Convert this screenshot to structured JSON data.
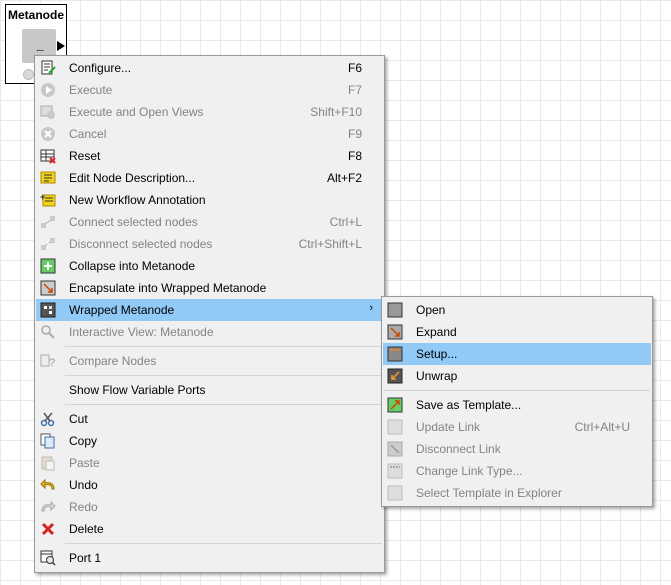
{
  "node": {
    "title": "Metanode",
    "dots": "...."
  },
  "main_menu": {
    "items": [
      {
        "label": "Configure...",
        "shortcut": "F6",
        "icon": "configure-icon"
      },
      {
        "label": "Execute",
        "shortcut": "F7",
        "icon": "execute-icon"
      },
      {
        "label": "Execute and Open Views",
        "shortcut": "Shift+F10",
        "icon": "execute-open-views-icon"
      },
      {
        "label": "Cancel",
        "shortcut": "F9",
        "icon": "cancel-icon"
      },
      {
        "label": "Reset",
        "shortcut": "F8",
        "icon": "reset-icon"
      },
      {
        "label": "Edit Node Description...",
        "shortcut": "Alt+F2",
        "icon": "edit-description-icon"
      },
      {
        "label": "New Workflow Annotation",
        "shortcut": "",
        "icon": "annotation-icon"
      },
      {
        "label": "Connect selected nodes",
        "shortcut": "Ctrl+L",
        "icon": "connect-nodes-icon"
      },
      {
        "label": "Disconnect selected nodes",
        "shortcut": "Ctrl+Shift+L",
        "icon": "disconnect-nodes-icon"
      },
      {
        "label": "Collapse into Metanode",
        "shortcut": "",
        "icon": "collapse-metanode-icon"
      },
      {
        "label": "Encapsulate into Wrapped Metanode",
        "shortcut": "",
        "icon": "encapsulate-icon"
      },
      {
        "label": "Wrapped Metanode",
        "shortcut": "",
        "icon": "wrapped-metanode-icon"
      },
      {
        "label": "Interactive View: Metanode",
        "shortcut": "",
        "icon": "interactive-view-icon"
      },
      {
        "label": "Compare Nodes",
        "shortcut": "",
        "icon": "compare-nodes-icon"
      },
      {
        "label": "Show Flow Variable Ports",
        "shortcut": "",
        "icon": ""
      },
      {
        "label": "Cut",
        "shortcut": "",
        "icon": "cut-icon"
      },
      {
        "label": "Copy",
        "shortcut": "",
        "icon": "copy-icon"
      },
      {
        "label": "Paste",
        "shortcut": "",
        "icon": "paste-icon"
      },
      {
        "label": "Undo",
        "shortcut": "",
        "icon": "undo-icon"
      },
      {
        "label": "Redo",
        "shortcut": "",
        "icon": "redo-icon"
      },
      {
        "label": "Delete",
        "shortcut": "",
        "icon": "delete-icon"
      },
      {
        "label": "Port 1",
        "shortcut": "",
        "icon": "port-icon"
      }
    ]
  },
  "sub_menu": {
    "items": [
      {
        "label": "Open",
        "shortcut": "",
        "icon": "open-icon"
      },
      {
        "label": "Expand",
        "shortcut": "",
        "icon": "expand-icon"
      },
      {
        "label": "Setup...",
        "shortcut": "",
        "icon": "setup-icon"
      },
      {
        "label": "Unwrap",
        "shortcut": "",
        "icon": "unwrap-icon"
      },
      {
        "label": "Save as Template...",
        "shortcut": "",
        "icon": "save-template-icon"
      },
      {
        "label": "Update Link",
        "shortcut": "Ctrl+Alt+U",
        "icon": "update-link-icon"
      },
      {
        "label": "Disconnect Link",
        "shortcut": "",
        "icon": "disconnect-link-icon"
      },
      {
        "label": "Change Link Type...",
        "shortcut": "",
        "icon": "change-link-type-icon"
      },
      {
        "label": "Select Template in Explorer",
        "shortcut": "",
        "icon": "select-template-icon"
      }
    ]
  },
  "colors": {
    "highlight": "#91c9f7",
    "menu_bg": "#f0f0f0",
    "disabled_text": "#838383"
  }
}
